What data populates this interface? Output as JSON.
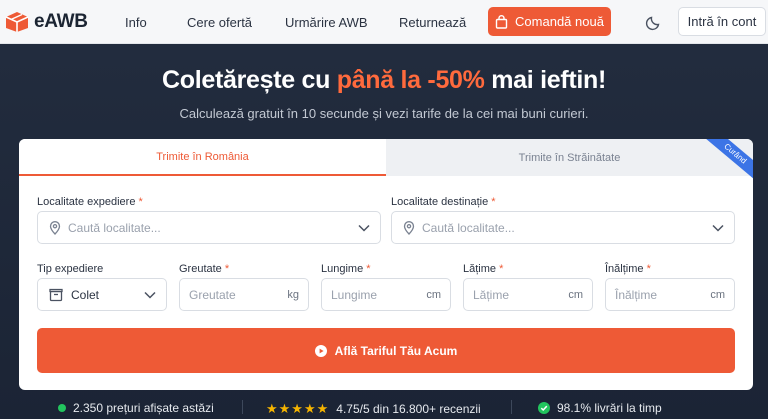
{
  "header": {
    "brand": "eAWB",
    "nav": [
      {
        "label": "Info"
      },
      {
        "label": "Cere ofertă"
      },
      {
        "label": "Urmărire AWB"
      },
      {
        "label": "Returnează"
      }
    ],
    "order_button": "Comandă nouă",
    "login_button": "Intră în cont"
  },
  "hero": {
    "headline_start": "Coletărește cu ",
    "headline_accent": "până la -50%",
    "headline_end": " mai ieftin!",
    "subline": "Calculează gratuit în 10 secunde și vezi tarife de la cei mai buni curieri."
  },
  "form": {
    "tabs": [
      {
        "label": "Trimite în România",
        "active": true
      },
      {
        "label": "Trimite în Străinătate",
        "active": false
      }
    ],
    "ribbon": "Curând",
    "origin": {
      "label": "Localitate expediere",
      "placeholder": "Caută localitate..."
    },
    "destination": {
      "label": "Localitate destinație",
      "placeholder": "Caută localitate..."
    },
    "type": {
      "label": "Tip expediere",
      "value": "Colet"
    },
    "weight": {
      "label": "Greutate",
      "placeholder": "Greutate",
      "unit": "kg"
    },
    "length": {
      "label": "Lungime",
      "placeholder": "Lungime",
      "unit": "cm"
    },
    "width": {
      "label": "Lățime",
      "placeholder": "Lățime",
      "unit": "cm"
    },
    "height": {
      "label": "Înălțime",
      "placeholder": "Înălțime",
      "unit": "cm"
    },
    "required_mark": "*",
    "submit": "Află Tariful Tău Acum"
  },
  "stats": {
    "prices": "2.350 prețuri afișate astăzi",
    "stars": "★★★★★",
    "rating": "4.75/5 din 16.800+ recenzii",
    "delivery": "98.1% livrări la timp"
  },
  "colors": {
    "accent": "#ee5a36",
    "navy": "#1f2a3c",
    "success": "#22c55e",
    "ribbon": "#3c74e6"
  }
}
